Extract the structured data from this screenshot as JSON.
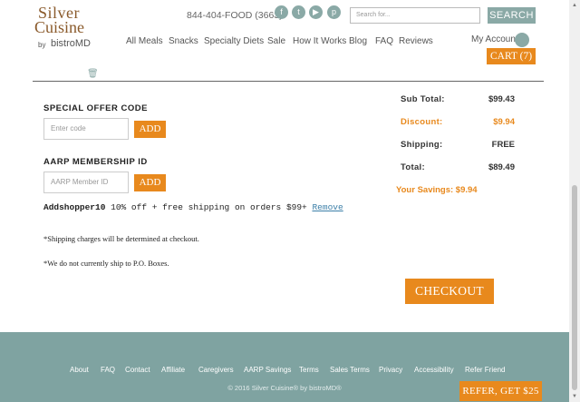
{
  "header": {
    "logo": {
      "line1": "Silver",
      "line2": "Cuisine",
      "by": "by",
      "brand": "bistroMD"
    },
    "phone": "844-404-FOOD (3663)",
    "social": [
      {
        "icon": "facebook-icon",
        "glyph": "f"
      },
      {
        "icon": "twitter-icon",
        "glyph": "t"
      },
      {
        "icon": "youtube-icon",
        "glyph": "▶"
      },
      {
        "icon": "pinterest-icon",
        "glyph": "p"
      }
    ],
    "search": {
      "placeholder": "Search for...",
      "button": "SEARCH"
    },
    "nav": [
      "All Meals",
      "Snacks",
      "Specialty Diets",
      "Sale",
      "How It Works",
      "Blog",
      "FAQ",
      "Reviews"
    ],
    "account": "My Account",
    "cart": "CART (7)"
  },
  "offer": {
    "title": "SPECIAL OFFER CODE",
    "placeholder": "Enter code",
    "add": "ADD"
  },
  "aarp": {
    "title": "AARP MEMBERSHIP ID",
    "placeholder": "AARP Member ID",
    "add": "ADD"
  },
  "promo": {
    "code": "Addshopper10",
    "desc": "10% off + free shipping on orders $99+",
    "remove": "Remove"
  },
  "notes": [
    "*Shipping charges will be determined at checkout.",
    "*We do not currently ship to P.O. Boxes."
  ],
  "totals": {
    "subtotal_label": "Sub Total:",
    "subtotal": "$99.43",
    "discount_label": "Discount:",
    "discount": "$9.94",
    "shipping_label": "Shipping:",
    "shipping": "FREE",
    "total_label": "Total:",
    "total": "$89.49",
    "savings": "Your Savings: $9.94"
  },
  "checkout": "CHECKOUT",
  "footer": {
    "links": [
      "About",
      "FAQ",
      "Contact",
      "Affiliate",
      "Caregivers",
      "AARP Savings",
      "Terms",
      "Sales Terms",
      "Privacy",
      "Accessibility",
      "Refer Friend"
    ],
    "copyright": "© 2016 Silver Cuisine® by bistroMD®",
    "refer": "REFER, GET $25"
  },
  "colors": {
    "accent": "#e8891d",
    "teal": "#7fa3a1",
    "link": "#3c7fa8"
  }
}
